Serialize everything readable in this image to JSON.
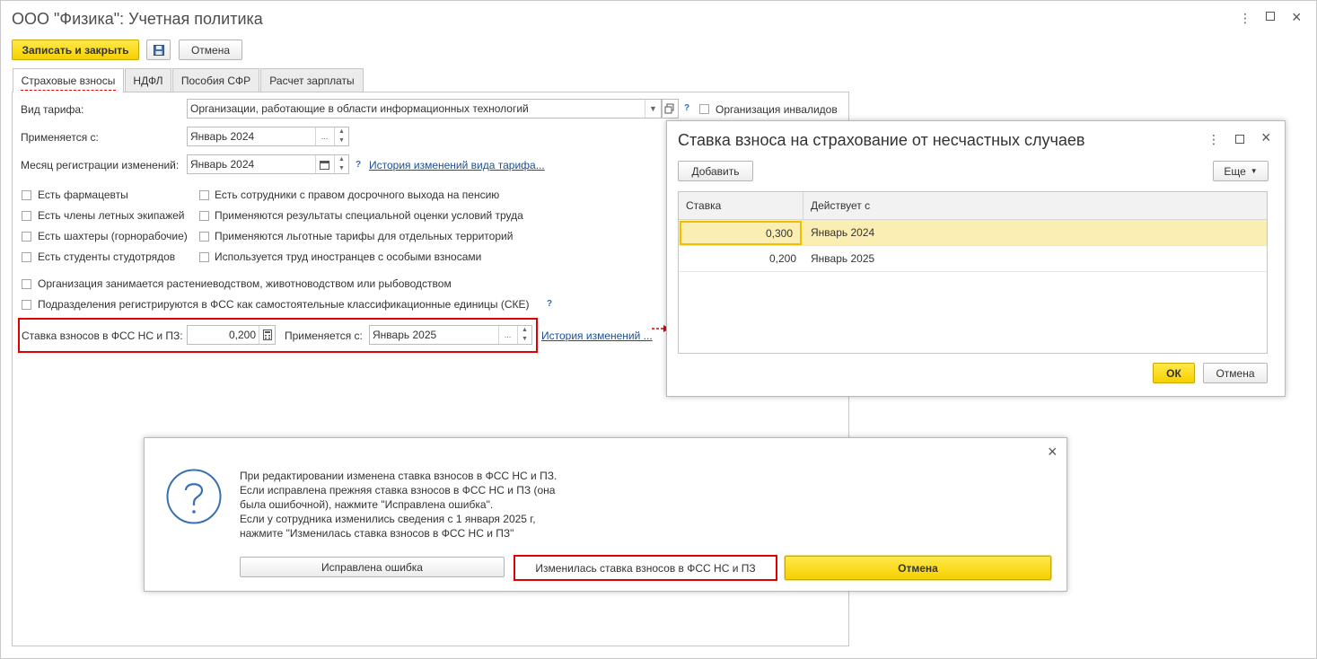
{
  "window": {
    "title": "ООО \"Физика\": Учетная политика"
  },
  "toolbar": {
    "save_close": "Записать и закрыть",
    "cancel": "Отмена"
  },
  "tabs": [
    {
      "label": "Страховые взносы",
      "active": true
    },
    {
      "label": "НДФЛ",
      "active": false
    },
    {
      "label": "Пособия СФР",
      "active": false
    },
    {
      "label": "Расчет зарплаты",
      "active": false
    }
  ],
  "form": {
    "tariff_label": "Вид тарифа:",
    "tariff_value": "Организации, работающие в области информационных технологий",
    "disabled_org": "Организация инвалидов",
    "applies_label": "Применяется с:",
    "applies_value": "Январь 2024",
    "month_label": "Месяц регистрации изменений:",
    "month_value": "Январь 2024",
    "tariff_history": "История изменений вида тарифа...",
    "checkboxes_left": [
      "Есть фармацевты",
      "Есть члены летных экипажей",
      "Есть шахтеры (горнорабочие)",
      "Есть студенты студотрядов"
    ],
    "checkboxes_right": [
      "Есть сотрудники с правом досрочного выхода на пенсию",
      "Применяются результаты специальной оценки условий труда",
      "Применяются льготные тарифы для отдельных территорий",
      "Используется труд иностранцев с особыми взносами"
    ],
    "cb_agro": "Организация занимается растениеводством, животноводством или рыбоводством",
    "cb_ske": "Подразделения регистрируются в ФСС как самостоятельные классификационные единицы (СКЕ)",
    "fss_label": "Ставка взносов в ФСС НС и ПЗ:",
    "fss_value": "0,200",
    "fss_applies_label": "Применяется с:",
    "fss_applies_value": "Январь 2025",
    "fss_history": "История изменений ..."
  },
  "rate_dialog": {
    "title": "Ставка взноса на страхование от несчастных случаев",
    "add": "Добавить",
    "more": "Еще",
    "col_rate": "Ставка",
    "col_from": "Действует с",
    "rows": [
      {
        "rate": "0,300",
        "from": "Январь 2024"
      },
      {
        "rate": "0,200",
        "from": "Январь 2025"
      }
    ],
    "ok": "ОК",
    "cancel": "Отмена"
  },
  "question_dialog": {
    "lines": [
      "При редактировании изменена ставка взносов в ФСС НС и ПЗ.",
      "Если исправлена прежняя ставка взносов в ФСС НС и ПЗ (она",
      "была ошибочной), нажмите \"Исправлена ошибка\".",
      "Если у сотрудника изменились сведения с 1 января 2025 г,",
      "нажмите \"Изменилась ставка взносов в ФСС НС и ПЗ\""
    ],
    "btn_fixed": "Исправлена ошибка",
    "btn_changed": "Изменилась ставка взносов в ФСС НС и ПЗ",
    "btn_cancel": "Отмена"
  },
  "colors": {
    "accent_yellow": "#f5d000",
    "highlight_red": "#e00000",
    "link_blue": "#1f4f8f",
    "selected_row": "#fbeeb2"
  }
}
